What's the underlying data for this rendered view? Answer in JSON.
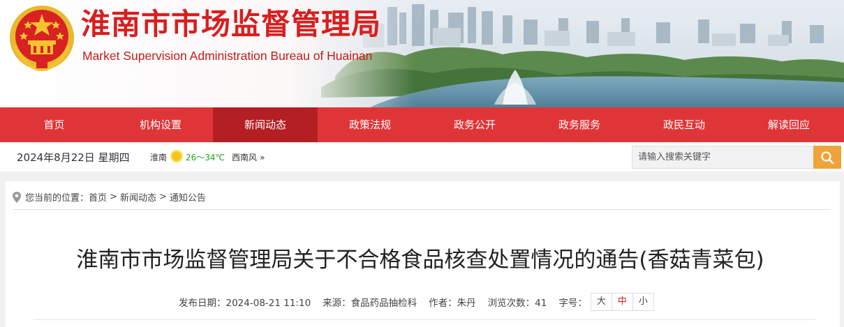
{
  "header": {
    "title": "淮南市市场监督管理局",
    "subtitle": "Market Supervision Administration Bureau of Huainan"
  },
  "nav": {
    "items": [
      {
        "label": "首页"
      },
      {
        "label": "机构设置"
      },
      {
        "label": "新闻动态",
        "active": true
      },
      {
        "label": "政策法规"
      },
      {
        "label": "政务公开"
      },
      {
        "label": "政务服务"
      },
      {
        "label": "政民互动"
      },
      {
        "label": "解读回应"
      }
    ]
  },
  "infobar": {
    "date": "2024年8月22日  星期四",
    "city": "淮南",
    "weather_icon": "sun-icon",
    "temperature": "26～34℃",
    "wind": "西南风",
    "more": "»",
    "search_placeholder": "请输入搜索关键字"
  },
  "breadcrumb": {
    "prefix": "您当前的位置：",
    "items": [
      "首页",
      "新闻动态",
      "通知公告"
    ],
    "separator": ">"
  },
  "article": {
    "title": "淮南市市场监督管理局关于不合格食品核查处置情况的通告(香菇青菜包)",
    "meta": {
      "date_label": "发布日期：",
      "date": "2024-08-21 11:10",
      "source_label": "来源：",
      "source": "食品药品抽检科",
      "author_label": "作者：",
      "author": "朱丹",
      "views_label": "浏览次数：",
      "views": "41",
      "fontsize_label": "字号：",
      "fontsize_options": [
        "大",
        "中",
        "小"
      ],
      "fontsize_selected": "中"
    }
  },
  "colors": {
    "brand_red": "#e03538",
    "nav_active": "#b31f22",
    "title_red": "#d91e1e",
    "search_button": "#f0a33a",
    "temperature_green": "#1aa31a"
  }
}
